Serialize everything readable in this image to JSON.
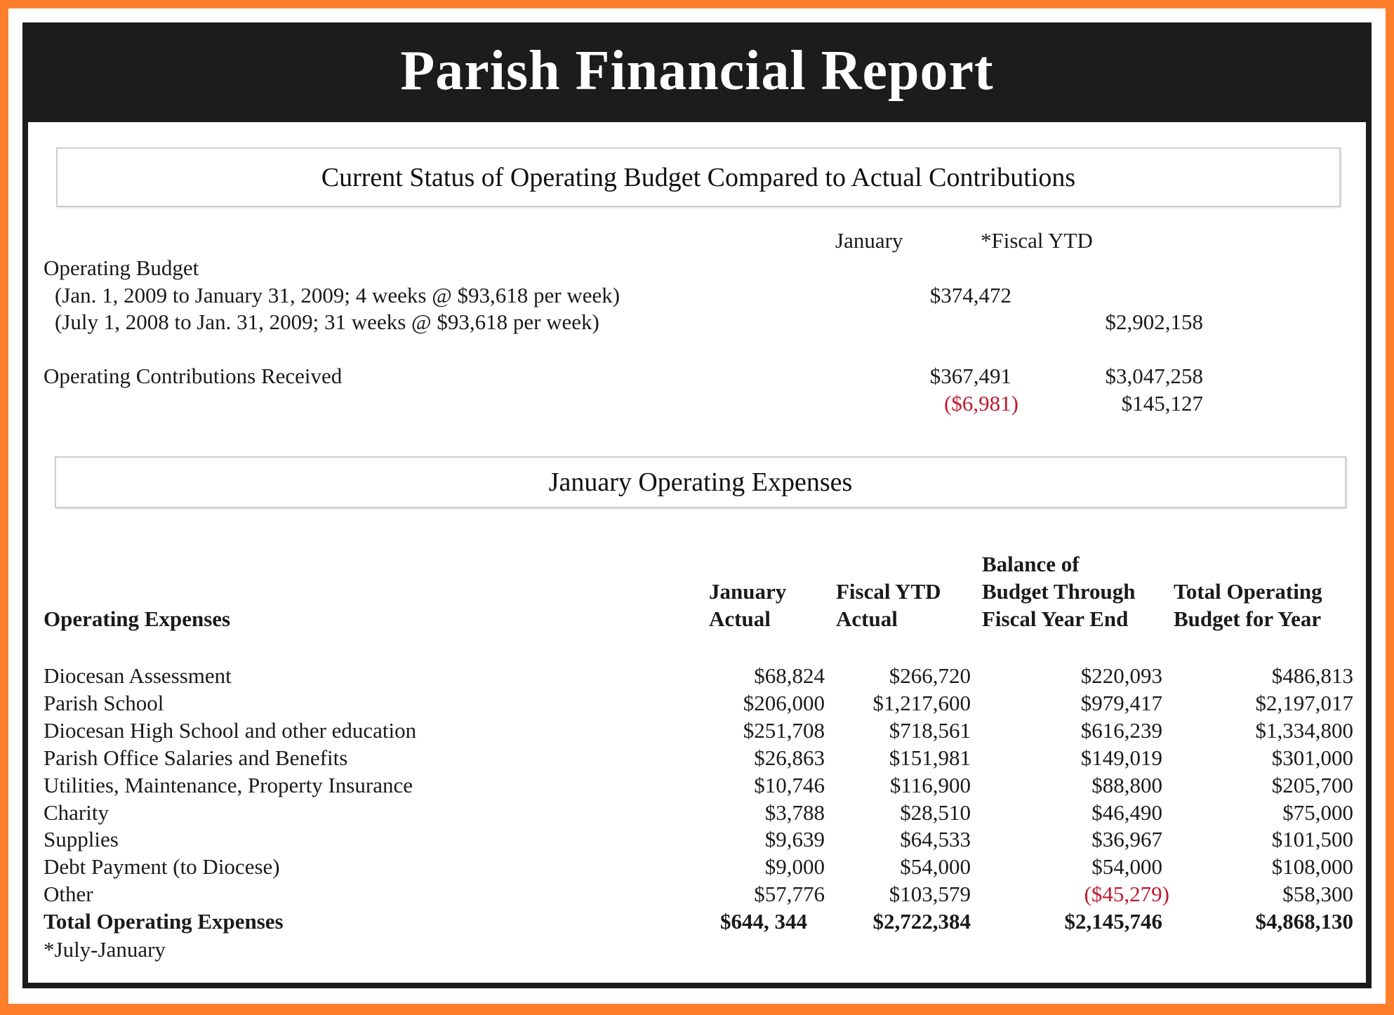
{
  "title": "Parish Financial Report",
  "section1": {
    "heading": "Current Status of Operating Budget Compared to Actual Contributions",
    "col_headers": [
      "January",
      "*Fiscal YTD"
    ],
    "operating_budget_label": "Operating Budget",
    "budget_rows": [
      {
        "label": "(Jan. 1, 2009 to January 31, 2009; 4 weeks @ $93,618 per week)",
        "january": "$374,472",
        "fiscal_ytd": ""
      },
      {
        "label": "(July 1, 2008 to Jan. 31, 2009; 31 weeks @ $93,618 per week)",
        "january": "",
        "fiscal_ytd": "$2,902,158"
      }
    ],
    "contributions_label": "Operating Contributions Received",
    "contributions": {
      "january": "$367,491",
      "fiscal_ytd": "$3,047,258"
    },
    "variance": {
      "january": "($6,981)",
      "fiscal_ytd": "$145,127"
    }
  },
  "section2": {
    "heading": "January Operating Expenses",
    "columns": [
      {
        "line1": "",
        "line2": "",
        "line3": "Operating Expenses"
      },
      {
        "line1": "",
        "line2": "January",
        "line3": "Actual"
      },
      {
        "line1": "",
        "line2": "Fiscal YTD",
        "line3": "Actual"
      },
      {
        "line1": "Balance of",
        "line2": "Budget Through",
        "line3": "Fiscal Year End"
      },
      {
        "line1": "",
        "line2": "Total Operating",
        "line3": "Budget for Year"
      }
    ],
    "rows": [
      {
        "label": "Diocesan Assessment",
        "jan_actual": "$68,824",
        "ytd_actual": "$266,720",
        "balance": "$220,093",
        "total_budget": "$486,813"
      },
      {
        "label": "Parish School",
        "jan_actual": "$206,000",
        "ytd_actual": "$1,217,600",
        "balance": "$979,417",
        "total_budget": "$2,197,017"
      },
      {
        "label": "Diocesan High School and other education",
        "jan_actual": "$251,708",
        "ytd_actual": "$718,561",
        "balance": "$616,239",
        "total_budget": "$1,334,800"
      },
      {
        "label": "Parish Office Salaries and Benefits",
        "jan_actual": "$26,863",
        "ytd_actual": "$151,981",
        "balance": "$149,019",
        "total_budget": "$301,000"
      },
      {
        "label": "Utilities, Maintenance, Property Insurance",
        "jan_actual": "$10,746",
        "ytd_actual": "$116,900",
        "balance": "$88,800",
        "total_budget": "$205,700"
      },
      {
        "label": "Charity",
        "jan_actual": "$3,788",
        "ytd_actual": "$28,510",
        "balance": "$46,490",
        "total_budget": "$75,000"
      },
      {
        "label": "Supplies",
        "jan_actual": "$9,639",
        "ytd_actual": "$64,533",
        "balance": "$36,967",
        "total_budget": "$101,500"
      },
      {
        "label": "Debt Payment (to Diocese)",
        "jan_actual": "$9,000",
        "ytd_actual": "$54,000",
        "balance": "$54,000",
        "total_budget": "$108,000"
      },
      {
        "label": "Other",
        "jan_actual": "$57,776",
        "ytd_actual": "$103,579",
        "balance": "($45,279)",
        "total_budget": "$58,300"
      }
    ],
    "total": {
      "label": "Total Operating Expenses",
      "jan_actual": "$644, 344",
      "ytd_actual": "$2,722,384",
      "balance": "$2,145,746",
      "total_budget": "$4,868,130"
    }
  },
  "footnote": "*July-January",
  "colors": {
    "frame_orange": "#fd7f2c",
    "title_bar": "#1c1c1c",
    "negative_red": "#c0192f"
  }
}
